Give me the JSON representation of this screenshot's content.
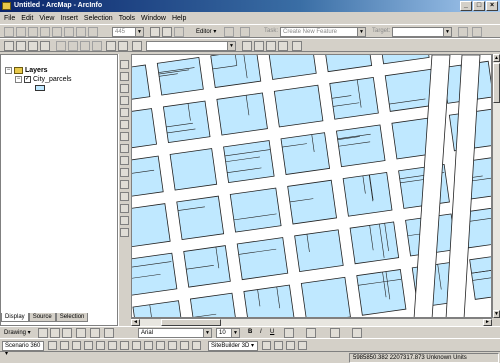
{
  "window": {
    "title": "Untitled - ArcMap - ArcInfo",
    "controls": [
      "_",
      "□",
      "×"
    ]
  },
  "menu": [
    "File",
    "Edit",
    "View",
    "Insert",
    "Selection",
    "Tools",
    "Window",
    "Help"
  ],
  "toolbar1": {
    "scale_value": "445",
    "editor_label": "Editor ▾",
    "task_label": "Task:",
    "task_value": "Create New Feature",
    "target_label": "Target:"
  },
  "toc": {
    "root": "Layers",
    "layer": "City_parcels",
    "tabs": [
      "Display",
      "Source",
      "Selection"
    ],
    "swatch_color": "#bfe8ff"
  },
  "drawing": {
    "drawing_label": "Drawing ▾",
    "font_value": "Arial",
    "size_value": "10",
    "bold": "B",
    "italic": "I",
    "underline": "U"
  },
  "scene": {
    "scenario_label": "Scenario 360 ▾",
    "sitebuilder_label": "SiteBuilder 3D ▾"
  },
  "status": {
    "coords": "5985850.382  2207317.873 Unknown Units"
  },
  "colors": {
    "parcel_fill": "#bfe8ff",
    "parcel_stroke": "#222222",
    "street": "#ffffff"
  }
}
